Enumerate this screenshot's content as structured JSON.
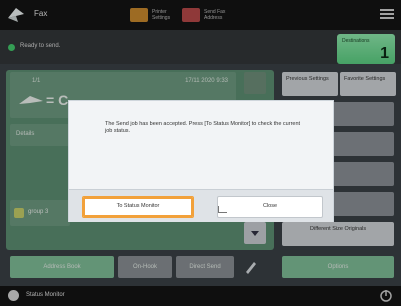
{
  "header": {
    "app_title": "Fax",
    "buttons": [
      {
        "label": "Printer Settings",
        "icon": "printer-settings-icon",
        "color": "#c98a2e"
      },
      {
        "label": "Send Fax Address",
        "icon": "address-icon",
        "color": "#b84a4a"
      }
    ],
    "menu_icon": "menu-icon"
  },
  "status": {
    "text": "Ready to send.",
    "dot_color": "#43c96c",
    "destinations_label": "Destinations",
    "destinations_count": "1"
  },
  "main": {
    "entry_index": "1/1",
    "entry_time": "17/11 2020 9:33",
    "details_label": "Details",
    "group_label": "group 3"
  },
  "options": [
    {
      "label": "Previous Settings"
    },
    {
      "label": "Favorite Settings"
    },
    {
      "label": ""
    },
    {
      "label": ""
    },
    {
      "label": ""
    },
    {
      "label": "Different Size Originals"
    }
  ],
  "bottom_row": {
    "address_book": "Address Book",
    "on_hook": "On-Hook",
    "direct_send": "Direct Send",
    "options": "Options"
  },
  "footer": {
    "status_monitor": "Status Monitor"
  },
  "dialog": {
    "message": "The Send job has been accepted. Press [To Status Monitor] to check the current job status.",
    "primary_button": "To Status Monitor",
    "secondary_button": "Close",
    "highlight_color": "#f2a13a"
  }
}
